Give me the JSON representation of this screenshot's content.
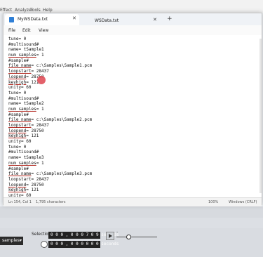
{
  "background_app": {
    "menu": [
      "Effect",
      "Analyze",
      "Tools",
      "Help"
    ]
  },
  "notepad": {
    "tabs": [
      {
        "label": "MyWSData.txt",
        "active": true
      },
      {
        "label": "WSData.txt",
        "active": false
      }
    ],
    "menu": [
      "File",
      "Edit",
      "View"
    ],
    "lines": [
      {
        "pre": "tune= 0",
        "u": "",
        "post": ""
      },
      {
        "pre": "#multisound#",
        "u": "",
        "post": ""
      },
      {
        "pre": "name= tSample1",
        "u": "",
        "post": ""
      },
      {
        "pre": "",
        "u": "num_samples",
        "post": "= 1"
      },
      {
        "pre": "#sample#",
        "u": "",
        "post": ""
      },
      {
        "pre": "",
        "u": "file_name",
        "post": "= c:\\Samples\\Sample1.pcm"
      },
      {
        "pre": "",
        "u": "loopstart",
        "post": "= 28437"
      },
      {
        "pre": "",
        "u": "loopend",
        "post": "= 28750"
      },
      {
        "pre": "",
        "u": "keyhigh",
        "post": "= 121"
      },
      {
        "pre": "unity= 60",
        "u": "",
        "post": ""
      },
      {
        "pre": "tune= 0",
        "u": "",
        "post": ""
      },
      {
        "pre": "#multisound#",
        "u": "",
        "post": ""
      },
      {
        "pre": "name= tSample2",
        "u": "",
        "post": ""
      },
      {
        "pre": "",
        "u": "num_samples",
        "post": "= 1"
      },
      {
        "pre": "#sample#",
        "u": "",
        "post": ""
      },
      {
        "pre": "",
        "u": "file_name",
        "post": "= c:\\Samples\\Sample2.pcm"
      },
      {
        "pre": "",
        "u": "loopstart",
        "post": "= 28437"
      },
      {
        "pre": "",
        "u": "loopend",
        "post": "= 28750"
      },
      {
        "pre": "",
        "u": "keyhigh",
        "post": "= 121"
      },
      {
        "pre": "unity= 60",
        "u": "",
        "post": ""
      },
      {
        "pre": "tune= 0",
        "u": "",
        "post": ""
      },
      {
        "pre": "#multisound#",
        "u": "",
        "post": ""
      },
      {
        "pre": "name= tSample3",
        "u": "",
        "post": ""
      },
      {
        "pre": "",
        "u": "num_samples",
        "post": "= 1"
      },
      {
        "pre": "#sample#",
        "u": "",
        "post": ""
      },
      {
        "pre": "",
        "u": "file_name",
        "post": "= c:\\Samples\\Sample3.pcm"
      },
      {
        "pre": "loopstart= 28437",
        "u": "",
        "post": ""
      },
      {
        "pre": "",
        "u": "loopend",
        "post": "= 28750"
      },
      {
        "pre": "",
        "u": "keyhigh",
        "post": "= 121"
      },
      {
        "pre": "unity= 60",
        "u": "",
        "post": ""
      }
    ],
    "status": {
      "position": "Ln 154, Col 1",
      "chars": "1,795 characters",
      "zoom": "100%",
      "eol": "Windows (CRLF)"
    }
  },
  "toolbar": {
    "samples_label": "samples",
    "selection_label": "Selection",
    "time1": "0 0 0 , 0 0 0 7 0 9  seconds",
    "time2": "0 0 0 , 0 0 0 0 0 0  seconds"
  },
  "colors": {
    "accent": "#2f7fd6",
    "cursor": "#e0505a"
  }
}
